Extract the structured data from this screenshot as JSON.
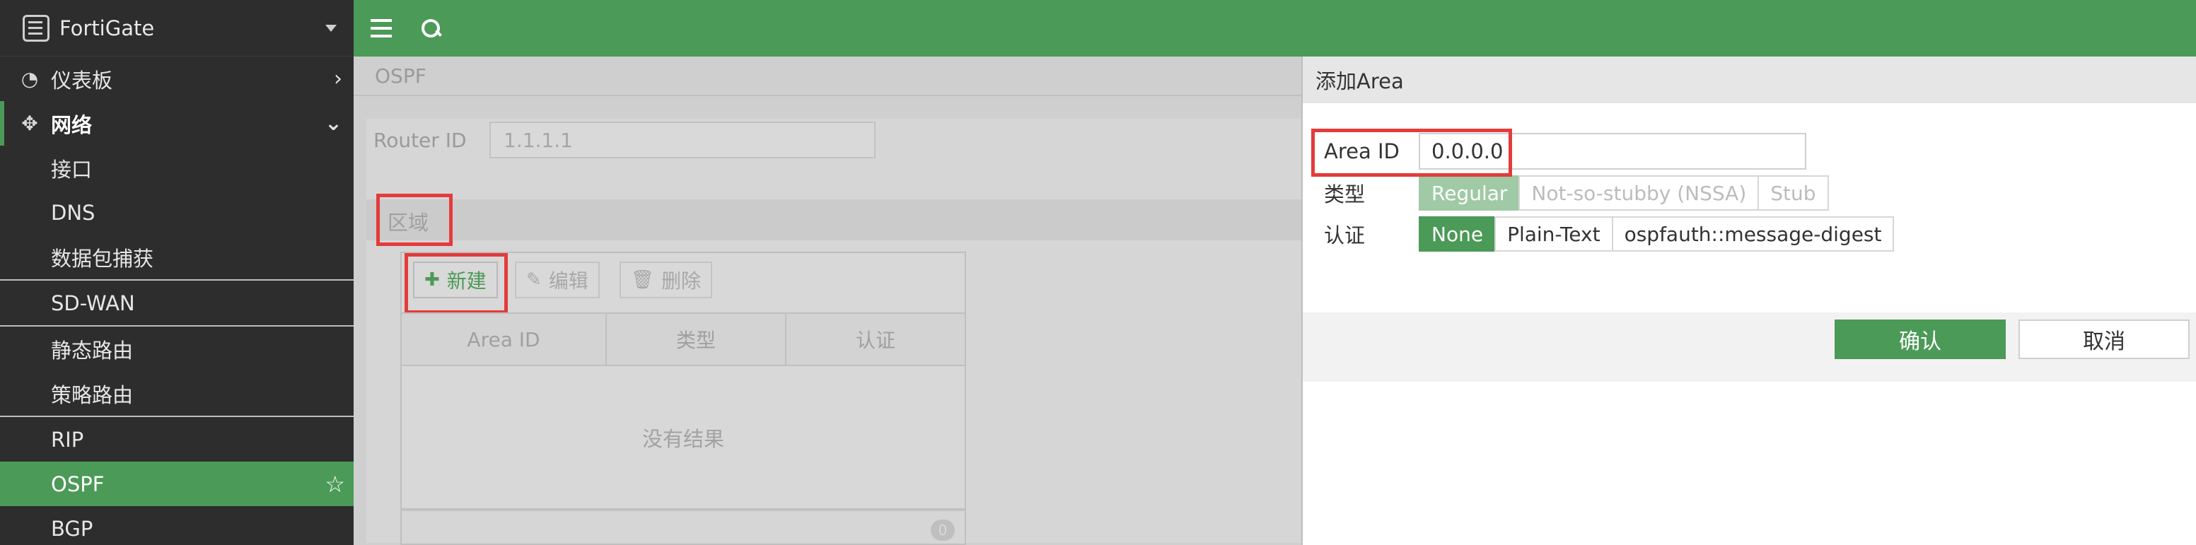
{
  "sidebar": {
    "brand": "FortiGate",
    "items": [
      {
        "label": "仪表板"
      },
      {
        "label": "网络"
      },
      {
        "label": "接口"
      },
      {
        "label": "DNS"
      },
      {
        "label": "数据包捕获"
      },
      {
        "label": "SD-WAN"
      },
      {
        "label": "静态路由"
      },
      {
        "label": "策略路由"
      },
      {
        "label": "RIP"
      },
      {
        "label": "OSPF"
      },
      {
        "label": "BGP"
      }
    ]
  },
  "main": {
    "page_title": "OSPF",
    "router_id_label": "Router ID",
    "router_id_value": "1.1.1.1",
    "area_section_title": "区域",
    "toolbar": {
      "new": "新建",
      "edit": "编辑",
      "delete": "删除"
    },
    "table": {
      "columns": [
        "Area ID",
        "类型",
        "认证"
      ],
      "empty_text": "没有结果",
      "count": "0"
    }
  },
  "dialog": {
    "title": "添加Area",
    "area_id_label": "Area ID",
    "area_id_value": "0.0.0.0",
    "type_label": "类型",
    "type_options": [
      "Regular",
      "Not-so-stubby (NSSA)",
      "Stub"
    ],
    "type_selected": "Regular",
    "auth_label": "认证",
    "auth_options": [
      "None",
      "Plain-Text",
      "ospfauth::message-digest"
    ],
    "auth_selected": "None",
    "ok": "确认",
    "cancel": "取消"
  },
  "colors": {
    "brand_green": "#4b9a57",
    "highlight_red": "#e43b3b",
    "sidebar_bg": "#2d2d2d"
  }
}
